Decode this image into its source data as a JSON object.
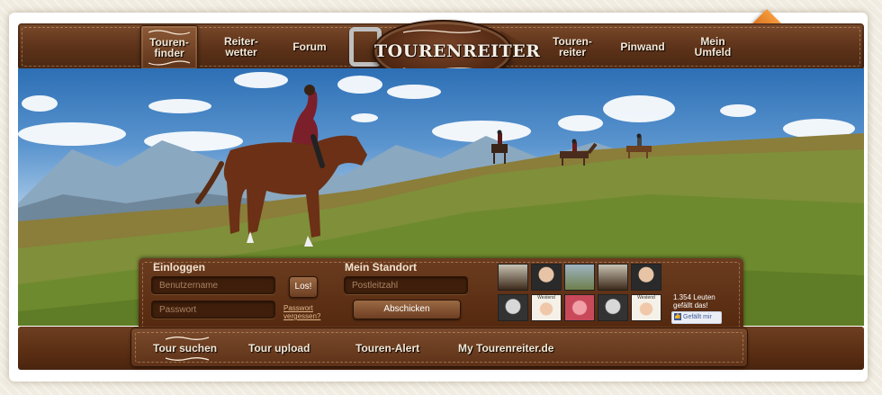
{
  "top_nav": {
    "items": [
      {
        "label": "Touren-\nfinder",
        "active": true
      },
      {
        "label": "Reiter-\nwetter"
      },
      {
        "label": "Forum"
      },
      {
        "label": "Touren-\nreiter"
      },
      {
        "label": "Pinwand"
      },
      {
        "label": "Mein\nUmfeld"
      }
    ]
  },
  "logo": {
    "text": "TOURENREITER"
  },
  "login": {
    "title": "Einloggen",
    "username_placeholder": "Benutzername",
    "password_placeholder": "Passwort",
    "submit_label": "Los!",
    "forgot_label": "Passwort\nvergessen?"
  },
  "location": {
    "title": "Mein Standort",
    "zip_placeholder": "Postleitzahl",
    "submit_label": "Abschicken"
  },
  "facebook": {
    "likes_text": "1.354 Leuten\ngefällt das!",
    "like_button": "Gefällt mir",
    "face_labels": [
      "",
      "",
      "",
      "",
      "",
      "",
      "Westend",
      "",
      "",
      "Westend"
    ]
  },
  "bottom_nav": {
    "items": [
      {
        "label": "Tour suchen",
        "active": true
      },
      {
        "label": "Tour upload"
      },
      {
        "label": "Touren-Alert"
      },
      {
        "label": "My Tourenreiter.de"
      }
    ]
  },
  "colors": {
    "leather_dark": "#4b2712",
    "leather_mid": "#6b3c1f",
    "ribbon": "#f08a2e",
    "text_light": "#f4e8d6"
  }
}
